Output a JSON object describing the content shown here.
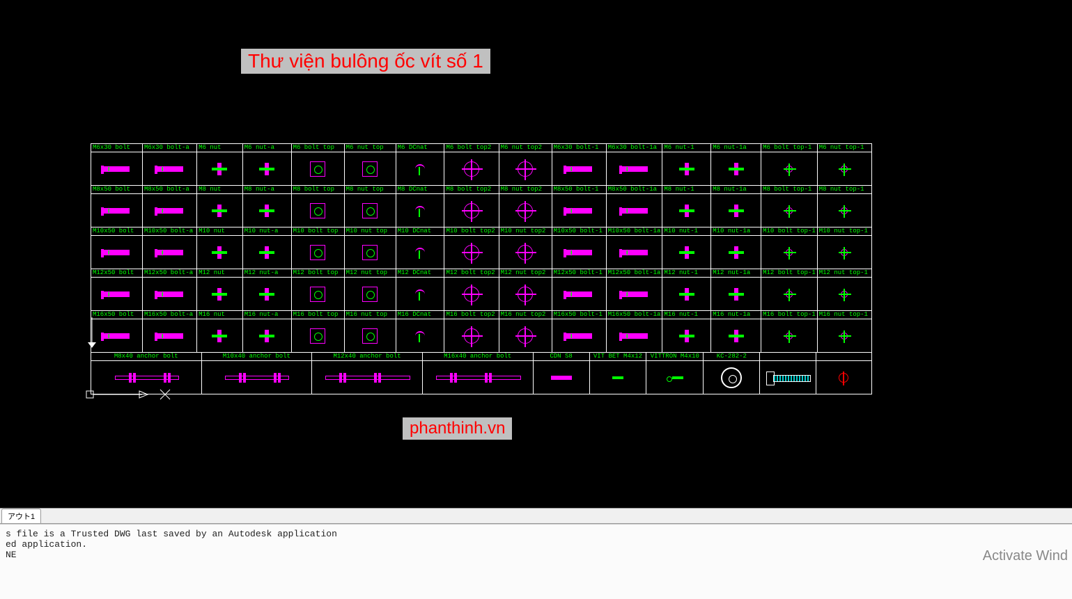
{
  "title": "Thư viện bulông ốc vít số 1",
  "watermark": "phanthinh.vn",
  "tab_label": "アウト1",
  "command_log": "s file is a Trusted DWG last saved by an Autodesk application\ned application.\nNE",
  "activate_text": "Activate Wind",
  "rows": [
    [
      "M6x30 bolt",
      "M6x30 bolt-a",
      "M6 nut",
      "M6 nut-a",
      "M6 bolt top",
      "M6 nut top",
      "M6 DCnat",
      "M6 bolt top2",
      "M6 nut top2",
      "M6x30 bolt-1",
      "M6x30 bolt-1a",
      "M6 nut-1",
      "M6 nut-1a",
      "M6 bolt top-1",
      "M6 nut top-1"
    ],
    [
      "M8x50 bolt",
      "M8x50 bolt-a",
      "M8 nut",
      "M8 nut-a",
      "M8 bolt top",
      "M8 nut top",
      "M8 DCnat",
      "M8 bolt top2",
      "M8 nut top2",
      "M8x50 bolt-1",
      "M8x50 bolt-1a",
      "M8 nut-1",
      "M8 nut-1a",
      "M8 bolt top-1",
      "M8 nut top-1"
    ],
    [
      "M10x50 bolt",
      "M10x50 bolt-a",
      "M10 nut",
      "M10 nut-a",
      "M10 bolt top",
      "M10 nut top",
      "M10 DCnat",
      "M10 bolt top2",
      "M10 nut top2",
      "M10x50 bolt-1",
      "M10x50 bolt-1a",
      "M10 nut-1",
      "M10 nut-1a",
      "M10 bolt top-1",
      "M10 nut top-1"
    ],
    [
      "M12x50 bolt",
      "M12x50 bolt-a",
      "M12 nut",
      "M12 nut-a",
      "M12 bolt top",
      "M12 nut top",
      "M12 DCnat",
      "M12 bolt top2",
      "M12 nut top2",
      "M12x50 bolt-1",
      "M12x50 bolt-1a",
      "M12 nut-1",
      "M12 nut-1a",
      "M12 bolt top-1",
      "M12 nut top-1"
    ],
    [
      "M16x50 bolt",
      "M16x50 bolt-a",
      "M16 nut",
      "M16 nut-a",
      "M16 bolt top",
      "M16 nut top",
      "M16 DCnat",
      "M16 bolt top2",
      "M16 nut top2",
      "M16x50 bolt-1",
      "M16x50 bolt-1a",
      "M16 nut-1",
      "M16 nut-1a",
      "M16 bolt top-1",
      "M16 nut top-1"
    ]
  ],
  "bottom_row": [
    "M8x40 anchor bolt",
    "M10x40 anchor bolt",
    "M12x40 anchor bolt",
    "M16x40 anchor bolt",
    "CDN S8",
    "VIT BET M4x12",
    "VITTRON M4x10",
    "KC-282-2",
    "",
    ""
  ]
}
